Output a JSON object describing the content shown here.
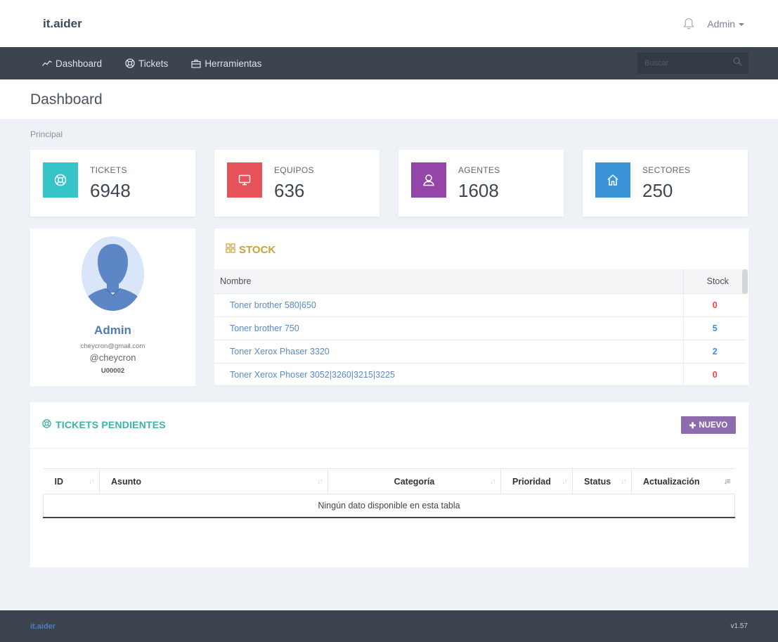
{
  "app": {
    "brand": "it.aider"
  },
  "user_menu": {
    "label": "Admin"
  },
  "nav": {
    "items": [
      {
        "label": "Dashboard",
        "icon": "trend-line-icon"
      },
      {
        "label": "Tickets",
        "icon": "lifebuoy-icon"
      },
      {
        "label": "Herramientas",
        "icon": "briefcase-icon"
      }
    ]
  },
  "search": {
    "placeholder": "Buscar"
  },
  "page": {
    "title": "Dashboard",
    "section": "Principal"
  },
  "stats": [
    {
      "label": "TICKETS",
      "value": "6948",
      "color": "#36c5c7",
      "icon": "lifebuoy-icon"
    },
    {
      "label": "EQUIPOS",
      "value": "636",
      "color": "#e5525a",
      "icon": "monitor-icon"
    },
    {
      "label": "AGENTES",
      "value": "1608",
      "color": "#9446a8",
      "icon": "agent-icon"
    },
    {
      "label": "SECTORES",
      "value": "250",
      "color": "#3c94d8",
      "icon": "home-icon"
    }
  ],
  "profile": {
    "name": "Admin",
    "email": "cheycron@gmail.com",
    "handle": "@cheycron",
    "code": "U00002"
  },
  "stock": {
    "title": "STOCK",
    "columns": [
      "Nombre",
      "Stock"
    ],
    "rows": [
      {
        "name": "Toner brother 580|650",
        "qty": "0",
        "status": "red"
      },
      {
        "name": "Toner brother 750",
        "qty": "5",
        "status": "blue"
      },
      {
        "name": "Toner Xerox Phaser 3320",
        "qty": "2",
        "status": "blue"
      },
      {
        "name": "Toner Xerox Phoser 3052|3260|3215|3225",
        "qty": "0",
        "status": "red"
      }
    ]
  },
  "pending": {
    "title": "TICKETS PENDIENTES",
    "new_label": "NUEVO",
    "columns": [
      "ID",
      "Asunto",
      "Categoría",
      "Prioridad",
      "Status",
      "Actualización"
    ],
    "empty_message": "Ningún dato disponible en esta tabla"
  },
  "footer": {
    "brand": "it.aider",
    "version": "v1.57"
  },
  "colors": {
    "navbar": "#3c4450",
    "accent_teal": "#3eb2a7",
    "accent_gold": "#caa13a",
    "accent_purple": "#8e6bac"
  }
}
